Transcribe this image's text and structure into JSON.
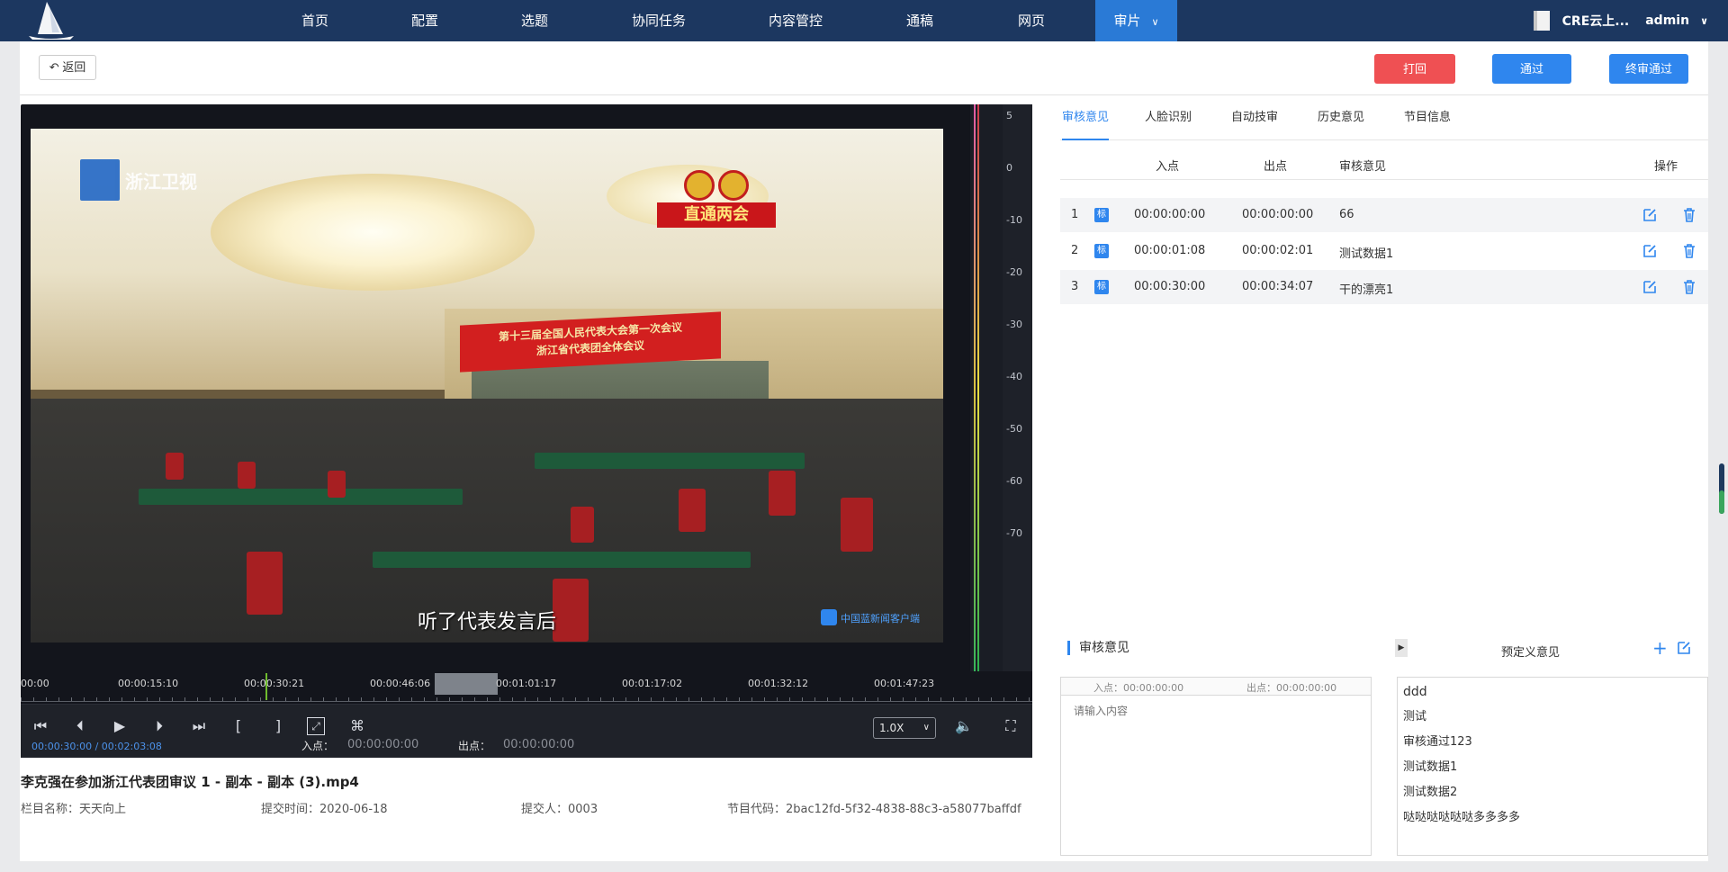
{
  "nav": {
    "items": [
      {
        "label": "首页"
      },
      {
        "label": "配置"
      },
      {
        "label": "选题"
      },
      {
        "label": "协同任务"
      },
      {
        "label": "内容管控"
      },
      {
        "label": "通稿"
      },
      {
        "label": "网页"
      },
      {
        "label": "审片",
        "active": true
      }
    ],
    "org": "CRE云上...",
    "user": "admin",
    "colors": {
      "bg": "#1c3760",
      "active": "#2a7ad6"
    }
  },
  "toolbar": {
    "back_label": "返回",
    "reject_label": "打回",
    "pass_label": "通过",
    "final_pass_label": "终审通过",
    "colors": {
      "reject": "#ef5053",
      "primary": "#2f86ee"
    }
  },
  "video": {
    "channel_logo": "浙江卫视",
    "live_badge": "直通两会",
    "banner_line1": "第十三届全国人民代表大会第一次会议",
    "banner_line2": "浙江省代表团全体会议",
    "subtitle": "听了代表发言后",
    "watermark": "中国蓝新闻客户端"
  },
  "meter": {
    "ticks": [
      "5",
      "0",
      "-10",
      "-20",
      "-30",
      "-40",
      "-50",
      "-60",
      "-70"
    ]
  },
  "timeline": {
    "labels": [
      "00:00",
      "00:00:15:10",
      "00:00:30:21",
      "00:00:46:06",
      "00:01:01:17",
      "00:01:17:02",
      "00:01:32:12",
      "00:01:47:23"
    ]
  },
  "controls": {
    "timecode": "00:00:30:00 / 00:02:03:08",
    "in_label": "入点：",
    "in_value": "00:00:00:00",
    "out_label": "出点：",
    "out_value": "00:00:00:00",
    "speed": "1.0X"
  },
  "file": {
    "title": "李克强在参加浙江代表团审议 1 - 副本 - 副本 (3).mp4",
    "column": "栏目名称：天天向上",
    "submit_time": "提交时间：2020-06-18",
    "submitter": "提交人：0003",
    "program_code": "节目代码：2bac12fd-5f32-4838-88c3-a58077baffdf"
  },
  "tabs": [
    {
      "label": "审核意见",
      "active": true
    },
    {
      "label": "人脸识别"
    },
    {
      "label": "自动技审"
    },
    {
      "label": "历史意见"
    },
    {
      "label": "节目信息"
    }
  ],
  "table": {
    "headers": {
      "in": "入点",
      "out": "出点",
      "opinion": "审核意见",
      "ops": "操作"
    },
    "rows": [
      {
        "idx": "1",
        "tag": "标",
        "in": "00:00:00:00",
        "out": "00:00:00:00",
        "opinion": "66"
      },
      {
        "idx": "2",
        "tag": "标",
        "in": "00:00:01:08",
        "out": "00:00:02:01",
        "opinion": "测试数据1"
      },
      {
        "idx": "3",
        "tag": "标",
        "in": "00:00:30:00",
        "out": "00:00:34:07",
        "opinion": "干的漂亮1"
      }
    ]
  },
  "opinion_form": {
    "title": "审核意见",
    "in_text": "入点：00:00:00:00",
    "out_text": "出点：00:00:00:00",
    "placeholder": "请输入内容"
  },
  "predefined": {
    "title": "预定义意见",
    "items": [
      "ddd",
      "测试",
      "审核通过123",
      "测试数据1",
      "测试数据2",
      "哒哒哒哒哒哒多多多多"
    ]
  }
}
